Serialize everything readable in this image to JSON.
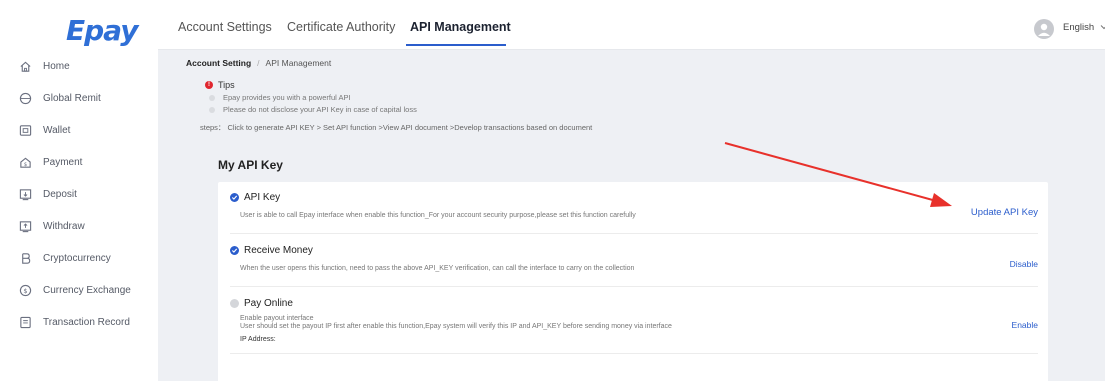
{
  "brand": {
    "logo_text": "Epay",
    "logo_color": "#2f6fd6"
  },
  "sidebar": {
    "items": [
      {
        "label": "Home",
        "icon": "home-icon"
      },
      {
        "label": "Global Remit",
        "icon": "globe-icon"
      },
      {
        "label": "Wallet",
        "icon": "wallet-icon"
      },
      {
        "label": "Payment",
        "icon": "payment-icon"
      },
      {
        "label": "Deposit",
        "icon": "deposit-icon"
      },
      {
        "label": "Withdraw",
        "icon": "withdraw-icon"
      },
      {
        "label": "Cryptocurrency",
        "icon": "bitcoin-icon"
      },
      {
        "label": "Currency Exchange",
        "icon": "exchange-icon"
      },
      {
        "label": "Transaction Record",
        "icon": "record-icon"
      }
    ]
  },
  "header": {
    "tabs": [
      {
        "label": "Account Settings",
        "active": false
      },
      {
        "label": "Certificate Authority",
        "active": false
      },
      {
        "label": "API Management",
        "active": true
      }
    ],
    "language": "English",
    "accent_color": "#2b5dcc"
  },
  "breadcrumb": {
    "root": "Account Setting",
    "current": "API Management"
  },
  "tips": {
    "title": "Tips",
    "lines": [
      "Epay provides you with a powerful API",
      "Please do not disclose your API Key in case of capital loss"
    ],
    "steps": "steps： Click to generate API KEY > Set API function >View API document >Develop transactions based on document"
  },
  "api_section": {
    "title": "My API Key",
    "rows": [
      {
        "title": "API Key",
        "enabled": true,
        "description": "User is able to call Epay interface when enable this function_For your account security purpose,please set this function carefully",
        "action": "Update API Key"
      },
      {
        "title": "Receive Money",
        "enabled": true,
        "description": "When the user opens this function, need to pass the above API_KEY verification, can call the interface to carry on the collection",
        "action": "Disable"
      },
      {
        "title": "Pay Online",
        "enabled": false,
        "description_1": "Enable payout interface",
        "description_2": "User should set the payout IP first after enable this function,Epay system will verify this IP and API_KEY before sending money via interface",
        "ip_label": "IP Address:",
        "action": "Enable"
      }
    ]
  },
  "annotation": {
    "arrow_color": "#e8312b"
  }
}
